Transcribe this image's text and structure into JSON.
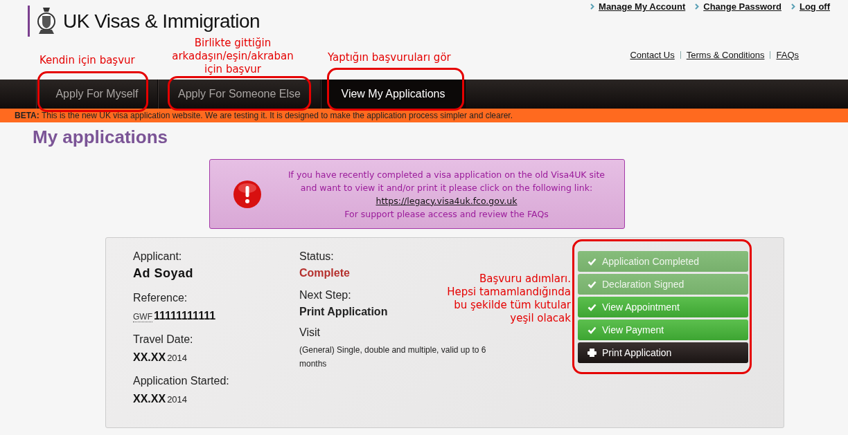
{
  "header": {
    "title": "UK Visas & Immigration",
    "account_links": [
      "Manage My Account",
      "Change Password",
      "Log off"
    ],
    "info_links": [
      "Contact Us",
      "Terms & Conditions",
      "FAQs"
    ]
  },
  "tabs": [
    {
      "label": "Apply For Myself",
      "selected": false
    },
    {
      "label": "Apply For Someone Else",
      "selected": false
    },
    {
      "label": "View My Applications",
      "selected": true
    }
  ],
  "beta_banner": {
    "tag": "BETA:",
    "text": "This is the new UK visa application website. We are testing it. It is designed to make the application process simpler and clearer."
  },
  "page_title": "My applications",
  "notice": {
    "lines": [
      "If you have recently completed a visa application on the old Visa4UK site",
      "and want to view it and/or print it please click on the following link:"
    ],
    "link": "https://legacy.visa4uk.fco.gov.uk",
    "footer": "For support please access and review the FAQs"
  },
  "application": {
    "left": [
      {
        "label": "Applicant:",
        "kind": "name",
        "value": "Ad Soyad"
      },
      {
        "label": "Reference:",
        "kind": "reference",
        "prefix": "GWF",
        "value": "11111111111"
      },
      {
        "label": "Travel Date:",
        "kind": "date",
        "value": "XX.XX",
        "year": "2014"
      },
      {
        "label": "Application Started:",
        "kind": "date",
        "value": "XX.XX",
        "year": "2014"
      }
    ],
    "status_label": "Status:",
    "status": "Complete",
    "next_step_label": "Next Step:",
    "next_step": "Print Application",
    "visa_type": "Visit",
    "visa_description": "(General) Single, double and multiple, valid up to 6 months",
    "steps": [
      {
        "label": "Application Completed",
        "kind": "done"
      },
      {
        "label": "Declaration Signed",
        "kind": "done"
      },
      {
        "label": "View Appointment",
        "kind": "current"
      },
      {
        "label": "View Payment",
        "kind": "current"
      },
      {
        "label": "Print Application",
        "kind": "print"
      }
    ]
  },
  "annotations": [
    {
      "text": "Kendin için başvur"
    },
    {
      "text": "Birlikte gittiğin\narkadaşın/eşin/akraban\niçin başvur"
    },
    {
      "text": "Yaptığın başvuruları gör"
    },
    {
      "text": "Başvuru adımları.\nHepsi tamamlandığında\nbu şekilde tüm kutular\nyeşil olacak"
    }
  ]
}
